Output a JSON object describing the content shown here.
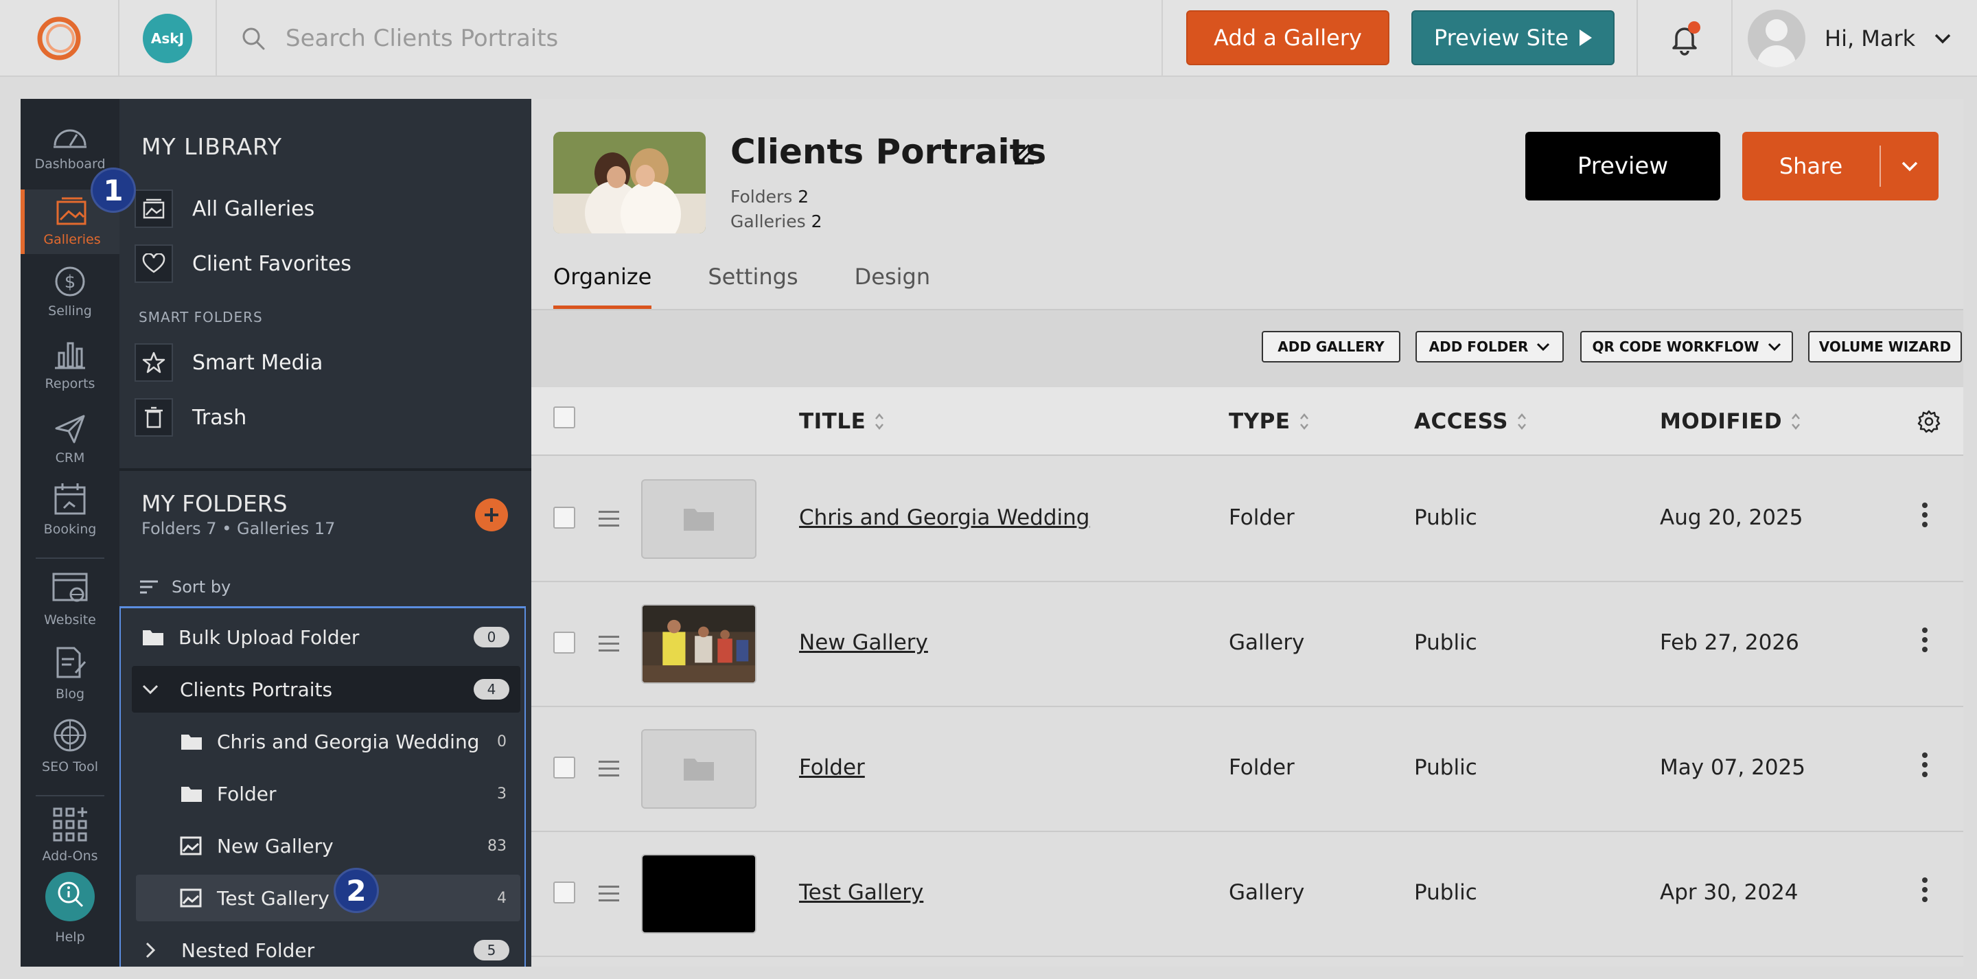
{
  "topbar": {
    "askj_label": "Ask",
    "search_placeholder": "Search Clients Portraits",
    "add_gallery": "Add a Gallery",
    "preview_site": "Preview Site",
    "greeting": "Hi, Mark"
  },
  "rail": {
    "items": [
      {
        "label": "Dashboard"
      },
      {
        "label": "Galleries"
      },
      {
        "label": "Selling"
      },
      {
        "label": "Reports"
      },
      {
        "label": "CRM"
      },
      {
        "label": "Booking"
      },
      {
        "label": "Website"
      },
      {
        "label": "Blog"
      },
      {
        "label": "SEO Tool"
      },
      {
        "label": "Add-Ons"
      },
      {
        "label": "Help"
      }
    ]
  },
  "library": {
    "title": "MY LIBRARY",
    "all_galleries": "All Galleries",
    "client_favorites": "Client Favorites",
    "smart_folders_label": "SMART FOLDERS",
    "smart_media": "Smart Media",
    "trash": "Trash",
    "folders_title": "MY FOLDERS",
    "folders_sub": "Folders 7 • Galleries 17",
    "sort_by": "Sort by",
    "tree": [
      {
        "label": "Bulk Upload Folder",
        "count": "0"
      },
      {
        "label": "Clients Portraits",
        "count": "4"
      },
      {
        "label": "Chris and Georgia Wedding",
        "count": "0"
      },
      {
        "label": "Folder",
        "count": "3"
      },
      {
        "label": "New Gallery",
        "count": "83"
      },
      {
        "label": "Test Gallery",
        "count": "4"
      },
      {
        "label": "Nested Folder",
        "count": "5"
      }
    ]
  },
  "badges": {
    "one": "1",
    "two": "2"
  },
  "main": {
    "title": "Clients Portraits",
    "folders_label": "Folders",
    "folders_count": "2",
    "galleries_label": "Galleries",
    "galleries_count": "2",
    "preview": "Preview",
    "share": "Share",
    "tabs": [
      {
        "label": "Organize"
      },
      {
        "label": "Settings"
      },
      {
        "label": "Design"
      }
    ],
    "toolbar": {
      "add_gallery": "ADD GALLERY",
      "add_folder": "ADD FOLDER",
      "qr_code": "QR CODE WORKFLOW",
      "volume_wizard": "VOLUME WIZARD"
    },
    "columns": {
      "title": "TITLE",
      "type": "TYPE",
      "access": "ACCESS",
      "modified": "MODIFIED"
    },
    "rows": [
      {
        "title": "Chris and Georgia Wedding",
        "type": "Folder",
        "access": "Public",
        "modified": "Aug 20, 2025"
      },
      {
        "title": "New Gallery",
        "type": "Gallery",
        "access": "Public",
        "modified": "Feb 27, 2026"
      },
      {
        "title": "Folder",
        "type": "Folder",
        "access": "Public",
        "modified": "May 07, 2025"
      },
      {
        "title": "Test Gallery",
        "type": "Gallery",
        "access": "Public",
        "modified": "Apr 30, 2024"
      }
    ]
  },
  "colors": {
    "accent": "#d9541e",
    "teal": "#2a7b82",
    "sidebar": "#2b3139",
    "rail": "#22272e",
    "badge": "#1f3a8a"
  }
}
